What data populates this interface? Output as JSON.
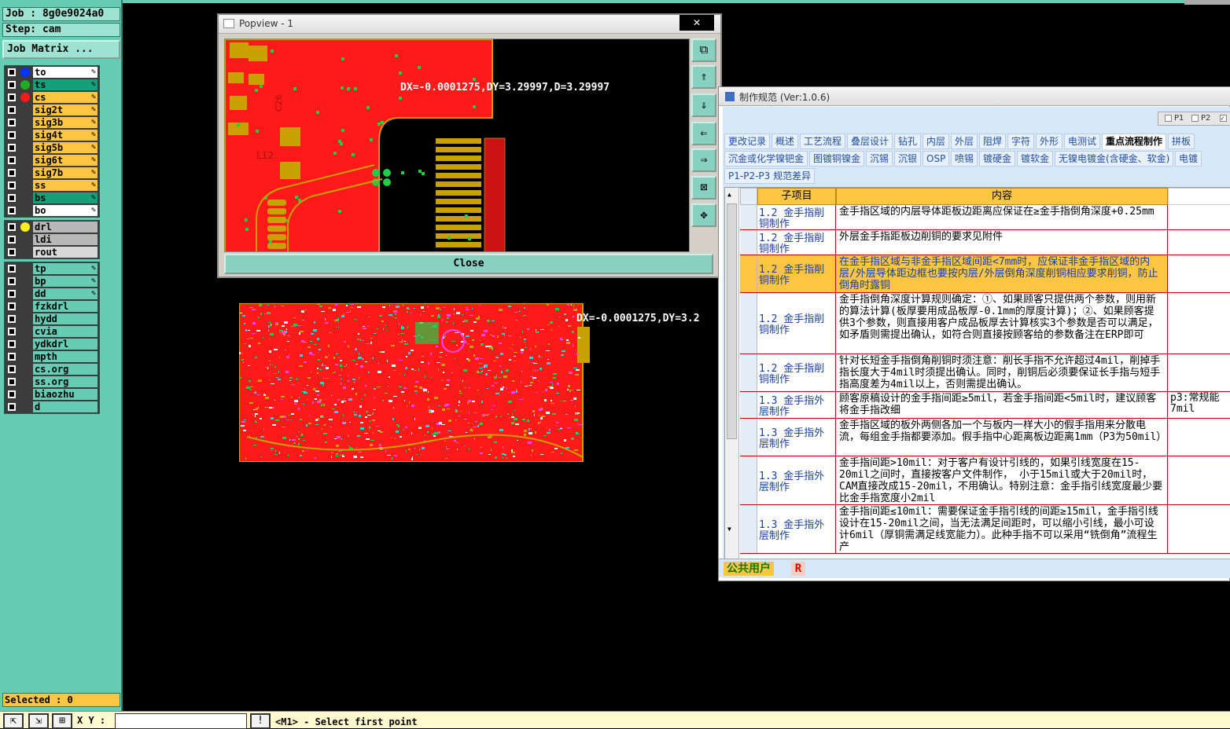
{
  "left_panel": {
    "job": "Job : 8g0e9024a0",
    "step": "Step: cam",
    "job_matrix": "Job Matrix ...",
    "layers_group1": [
      {
        "name": "to",
        "dot": "#0033ff",
        "bg": "#ffffff",
        "pen": true
      },
      {
        "name": "ts",
        "dot": "#22aa22",
        "bg": "#16a07a",
        "pen": true
      },
      {
        "name": "cs",
        "dot": "#ff1a1a",
        "bg": "#fcc542",
        "pen": true
      },
      {
        "name": "sig2t",
        "dot": "",
        "bg": "#fcc542",
        "pen": true
      },
      {
        "name": "sig3b",
        "dot": "",
        "bg": "#fcc542",
        "pen": true
      },
      {
        "name": "sig4t",
        "dot": "",
        "bg": "#fcc542",
        "pen": true
      },
      {
        "name": "sig5b",
        "dot": "",
        "bg": "#fcc542",
        "pen": true
      },
      {
        "name": "sig6t",
        "dot": "",
        "bg": "#fcc542",
        "pen": true
      },
      {
        "name": "sig7b",
        "dot": "",
        "bg": "#fcc542",
        "pen": true
      },
      {
        "name": "ss",
        "dot": "",
        "bg": "#fcc542",
        "pen": true
      },
      {
        "name": "bs",
        "dot": "",
        "bg": "#16a07a",
        "pen": true
      },
      {
        "name": "bo",
        "dot": "",
        "bg": "#ffffff",
        "pen": true
      }
    ],
    "layers_group2": [
      {
        "name": "drl",
        "dot": "#ffee22",
        "bg": "#b8b8b8",
        "pen": false
      },
      {
        "name": "ldi",
        "dot": "",
        "bg": "#b8b8b8",
        "pen": false
      },
      {
        "name": "rout",
        "dot": "",
        "bg": "#d8d8d8",
        "pen": false
      }
    ],
    "layers_group3": [
      {
        "name": "tp",
        "dot": "",
        "bg": "#66cdb4",
        "pen": true
      },
      {
        "name": "bp",
        "dot": "",
        "bg": "#66cdb4",
        "pen": true
      },
      {
        "name": "dd",
        "dot": "",
        "bg": "#66cdb4",
        "pen": true
      },
      {
        "name": "fzkdrl",
        "dot": "",
        "bg": "#66cdb4",
        "pen": false
      },
      {
        "name": "hydd",
        "dot": "",
        "bg": "#66cdb4",
        "pen": false
      },
      {
        "name": "cvia",
        "dot": "",
        "bg": "#66cdb4",
        "pen": false
      },
      {
        "name": "ydkdrl",
        "dot": "",
        "bg": "#66cdb4",
        "pen": false
      },
      {
        "name": "mpth",
        "dot": "",
        "bg": "#66cdb4",
        "pen": false
      },
      {
        "name": "cs.org",
        "dot": "",
        "bg": "#66cdb4",
        "pen": false
      },
      {
        "name": "ss.org",
        "dot": "",
        "bg": "#66cdb4",
        "pen": false
      },
      {
        "name": "biaozhu",
        "dot": "",
        "bg": "#66cdb4",
        "pen": false
      },
      {
        "name": "d",
        "dot": "",
        "bg": "#66cdb4",
        "pen": false
      }
    ],
    "selected": "Selected : 0"
  },
  "bottom_bar": {
    "xy_label": "X Y :",
    "xy_value": "",
    "message": "<M1> - Select first point"
  },
  "popview": {
    "title": "Popview - 1",
    "close_x": "✕",
    "close_label": "Close",
    "measure": "DX=-0.0001275,DY=3.29997,D=3.29997",
    "silk_labels": [
      "C26",
      "L12"
    ]
  },
  "board_measure": "DX=-0.0001275,DY=3.2",
  "spec": {
    "title": "制作规范 (Ver:1.0.6)",
    "p1": "P1",
    "p2": "P2",
    "tabs_row1": [
      "更改记录",
      "概述",
      "工艺流程",
      "叠层设计",
      "钻孔",
      "内层",
      "外层",
      "阻焊",
      "字符",
      "外形",
      "电测试",
      "重点流程制作",
      "拼板"
    ],
    "active_tab": "重点流程制作",
    "tabs_row2": [
      "沉金或化学镍钯金",
      "图镀铜镍金",
      "沉锡",
      "沉银",
      "OSP",
      "喷锡",
      "镀硬金",
      "镀软金",
      "无镍电镀金(含硬金、软金)",
      "电镀"
    ],
    "tabs_row3": [
      "P1-P2-P3 规范差异"
    ],
    "col_sub": "子项目",
    "col_content": "内容",
    "rows": [
      {
        "sub": "1.2 金手指削铜制作",
        "content": "金手指区域的内层导体距板边距离应保证在≥金手指倒角深度+0.25mm",
        "extra": "",
        "h": 32,
        "hl": false
      },
      {
        "sub": "1.2 金手指削铜制作",
        "content": "外层金手指距板边削铜的要求见附件",
        "extra": "",
        "h": 32,
        "hl": false
      },
      {
        "sub": "1.2 金手指削铜制作",
        "content": "在金手指区域与非金手指区域间距<7mm时，应保证非金手指区域的内层/外层导体距边框也要按内层/外层倒角深度削铜相应要求削铜，防止倒角时露铜",
        "extra": "",
        "h": 48,
        "hl": true
      },
      {
        "sub": "1.2 金手指削铜制作",
        "content": "金手指倒角深度计算规则确定：①、如果顾客只提供两个参数，则用新的算法计算(板厚要用成品板厚-0.1mm的厚度计算)；②、如果顾客提供3个参数，则直接用客户成品板厚去计算核实3个参数是否可以满足，如矛盾则需提出确认，如符合则直接按顾客给的参数备注在ERP即可",
        "extra": "",
        "h": 78,
        "hl": false
      },
      {
        "sub": "1.2 金手指削铜制作",
        "content": "针对长短金手指倒角削铜时须注意：削长手指不允许超过4mil，削掉手指长度大于4mil时须提出确认。同时，削铜后必须要保证长手指与短手指高度差为4mil以上，否则需提出确认。",
        "extra": "",
        "h": 48,
        "hl": false
      },
      {
        "sub": "1.3 金手指外层制作",
        "content": "顾客原稿设计的金手指间距≥5mil，若金手指间距<5mil时，建议顾客将金手指改细",
        "extra": "p3:常规能7mil",
        "h": 34,
        "hl": false
      },
      {
        "sub": "1.3 金手指外层制作",
        "content": "金手指区域的板外两侧各加一个与板内一样大小的假手指用来分散电流，每组金手指都要添加。假手指中心距离板边距离1mm（P3为50mil）",
        "extra": "",
        "h": 48,
        "hl": false
      },
      {
        "sub": "1.3 金手指外层制作",
        "content": "金手指间距>10mil：对于客户有设计引线的，如果引线宽度在15-20mil之间时，直接按客户文件制作， 小于15mil或大于20mil时，CAM直接改成15-20mil，不用确认。特别注意：金手指引线宽度最少要比金手指宽度小2mil",
        "extra": "",
        "h": 62,
        "hl": false
      },
      {
        "sub": "1.3 金手指外层制作",
        "content": "金手指间距≤10mil：需要保证金手指引线的间距≥15mil，金手指引线设计在15-20mil之间，当无法满足间距时，可以缩小引线，最小可设计6mil（厚铜需满足线宽能力）。此种手指不可以采用“铣倒角”流程生产",
        "extra": "",
        "h": 62,
        "hl": false
      }
    ],
    "status_user": "公共用户",
    "status_r": "R"
  }
}
